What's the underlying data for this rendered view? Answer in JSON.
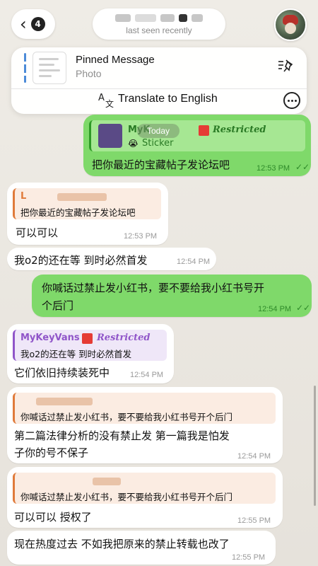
{
  "header": {
    "back_count": "4",
    "status": "last seen recently"
  },
  "pinned": {
    "title": "Pinned Message",
    "subtitle": "Photo"
  },
  "translate": {
    "label": "Translate to English"
  },
  "date_badge": "Today",
  "messages": [
    {
      "id": "m1",
      "direction": "out",
      "reply_name": "MyK",
      "reply_tag": "Restricted",
      "reply_sub": "Sticker",
      "reply_emoji": "😭",
      "text": "把你最近的宝藏帖子发论坛吧",
      "time": "12:53 PM"
    },
    {
      "id": "m2",
      "direction": "in",
      "reply_name": "L",
      "reply_text": "把你最近的宝藏帖子发论坛吧",
      "text": "可以可以",
      "time": "12:53 PM"
    },
    {
      "id": "m3",
      "direction": "in",
      "text": "我o2的还在等 到时必然首发",
      "time": "12:54 PM"
    },
    {
      "id": "m4",
      "direction": "out",
      "text_line1": "你喊话过禁止发小红书，要不要给我小红书号开",
      "text_line2": "个后门",
      "time": "12:54 PM"
    },
    {
      "id": "m5",
      "direction": "in",
      "reply_name": "MyKeyVans",
      "reply_tag": "Restricted",
      "reply_text": "我o2的还在等 到时必然首发",
      "text": "它们依旧持续装死中",
      "time": "12:54 PM"
    },
    {
      "id": "m6",
      "direction": "in",
      "reply_text": "你喊话过禁止发小红书，要不要给我小红书号开个后门",
      "text_line1": "第二篇法律分析的没有禁止发 第一篇我是怕发",
      "text_line2": "子你的号不保子",
      "time": "12:54 PM"
    },
    {
      "id": "m7",
      "direction": "in",
      "reply_text": "你喊话过禁止发小红书，要不要给我小红书号开个后门",
      "text": "可以可以 授权了",
      "time": "12:55 PM"
    },
    {
      "id": "m8",
      "direction": "in",
      "text": "现在热度过去 不如我把原来的禁止转载也改了",
      "time": "12:55 PM"
    }
  ],
  "colors": {
    "outgoing_bubble": "#7fd96a",
    "incoming_bubble": "#ffffff",
    "restricted_red": "#e53b35",
    "reply_orange": "#e07a3a",
    "reply_purple": "#9055c9"
  }
}
